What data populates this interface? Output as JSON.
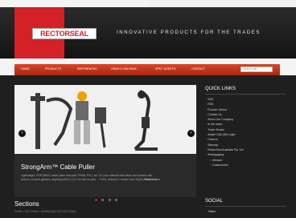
{
  "header": {
    "logo_text": "RECTORSEAL",
    "tagline": "INNOVATIVE PRODUCTS FOR THE TRADES"
  },
  "nav": {
    "items": [
      "HOME",
      "PRODUCTS",
      "REFERENCES",
      "OEM/CO-PACKING",
      "SPEC SHEETS",
      "CONTACT"
    ],
    "search_placeholder": "Search site"
  },
  "slider": {
    "title": "StrongArm™ Cable Puller",
    "description_line1": "Lightweight, PORTABLE cable puller that pulls THHN, PVC, etc. 2X your material that takes two workers with",
    "description_line2": "dozens of cable glasses, anything AMCO,LLC; for use on jobs ... TOOL reduces 1 worker cost 4X(4X)",
    "read_more": "Read more »",
    "prev_icon": "‹",
    "next_icon": "›"
  },
  "sections": {
    "title": "Sections",
    "breadcrumb": "HOME » SECTIONS » DOWNLOAD LIST SECTIONS"
  },
  "sidebar": {
    "quick_links_title": "QUICK LINKS",
    "links": [
      {
        "label": "SDS"
      },
      {
        "label": "RSS"
      },
      {
        "label": "Product Videos"
      },
      {
        "label": "Contact Us"
      },
      {
        "label": "About Our Company"
      },
      {
        "label": "In the news"
      },
      {
        "label": "Trade Shows"
      },
      {
        "label": "Ample Club Mkt Login"
      },
      {
        "label": "Careers"
      },
      {
        "label": "Sitemap"
      },
      {
        "label": "RectorSeal Australia Pty. Ltd."
      },
      {
        "label": "Smartgaging"
      },
      {
        "label": "Minisub"
      },
      {
        "label": "Dualconnect"
      }
    ],
    "social_title": "SOCIAL",
    "social_first": "Twitter"
  }
}
